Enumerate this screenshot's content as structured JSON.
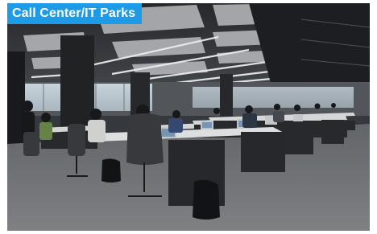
{
  "banner": {
    "title": "Call Center/IT Parks",
    "color": "#1e9be6"
  },
  "photo": {
    "subject": "open-plan office with rows of desks, workers at laptops and monitors"
  }
}
